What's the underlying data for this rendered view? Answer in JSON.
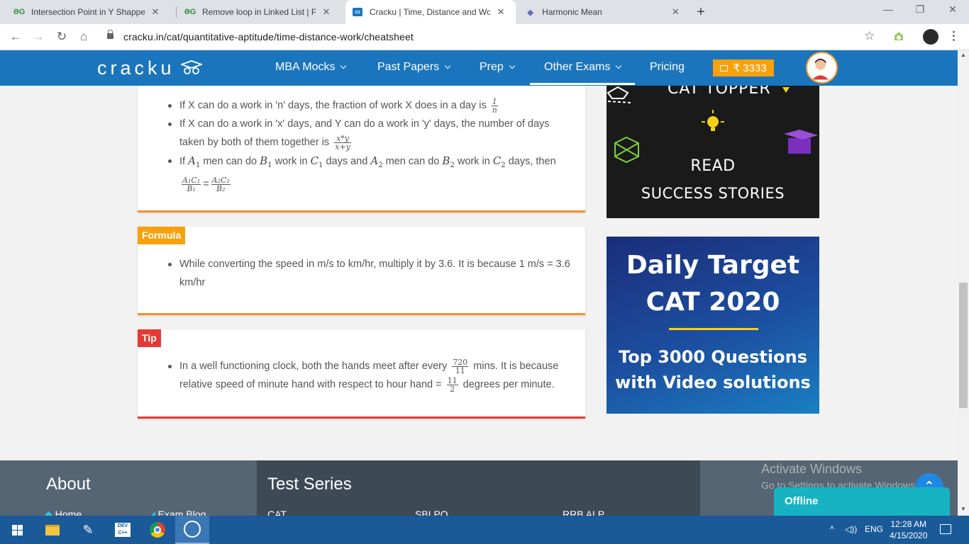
{
  "browser": {
    "tabs": [
      {
        "title": "Intersection Point in Y Shapped L",
        "favicon": "gfg-icon",
        "active": false
      },
      {
        "title": "Remove loop in Linked List | Prac",
        "favicon": "gfg-icon",
        "active": false
      },
      {
        "title": "Cracku | Time, Distance and Work",
        "favicon": "cracku-icon",
        "active": true
      },
      {
        "title": "Harmonic Mean",
        "favicon": "harmonic-mean-icon",
        "active": false
      }
    ],
    "favicon_text": "ƏG",
    "url": "cracku.in/cat/quantitative-aptitude/time-distance-work/cheatsheet"
  },
  "site": {
    "logo": "cracku",
    "nav": [
      {
        "label": "MBA Mocks",
        "dropdown": true
      },
      {
        "label": "Past Papers",
        "dropdown": true
      },
      {
        "label": "Prep",
        "dropdown": true
      },
      {
        "label": "Other Exams",
        "dropdown": true
      },
      {
        "label": "Pricing",
        "dropdown": false
      }
    ],
    "coins": "₹ 3333",
    "brand_color": "#1b75bc",
    "accent_color": "#f7a10d"
  },
  "cards": {
    "card1": {
      "b1_text": "If X can do a work in 'n' days, the fraction of work X does in a day is",
      "b1_num": "1",
      "b1_den": "n",
      "b2_text": "If X can do a work in 'x' days, and Y can do a work in 'y' days, the number of days taken by both of them together is",
      "b2_num": "x*y",
      "b2_den": "x+y",
      "b3_if": "If",
      "b3_men1": "men can do",
      "b3_work1": "work in",
      "b3_days_and": "days and",
      "b3_men2": "men can do",
      "b3_work2": "work in",
      "b3_days": "days,",
      "b3_then": "then",
      "b3_eq": "=",
      "bar_color": "#f0932b"
    },
    "formula": {
      "tag": "Formula",
      "text": "While converting the speed in m/s to km/hr, multiply it by 3.6. It is because 1 m/s = 3.6 km/hr",
      "tag_color": "#f7a10d"
    },
    "tip": {
      "tag": "Tip",
      "text_a": "In a well functioning clock, both the hands meet after every",
      "num1": "720",
      "den1": "11",
      "text_b": "mins. It is because relative speed of minute hand with respect to hour hand =",
      "num2": "11",
      "den2": "2",
      "text_c": "degrees per minute.",
      "tag_color": "#e53935"
    }
  },
  "ads": {
    "top": {
      "heading": "CAT TOPPER",
      "line1": "READ",
      "line2": "SUCCESS STORIES"
    },
    "bottom": {
      "line1": "Daily Target",
      "line2": "CAT 2020",
      "line3": "Top 3000 Questions",
      "line4": "with Video solutions"
    }
  },
  "footer": {
    "about": "About",
    "test_series": "Test Series",
    "links": [
      "Home",
      "Exam Blog",
      "CAT",
      "SBI PO",
      "RRB ALP"
    ]
  },
  "overlay": {
    "activate_title": "Activate Windows",
    "activate_sub": "Go to Settings to activate Windows.",
    "offline": "Offline"
  },
  "taskbar": {
    "lang": "ENG",
    "time": "12:28 AM",
    "date": "4/15/2020",
    "dev_label": "DEV C++"
  }
}
